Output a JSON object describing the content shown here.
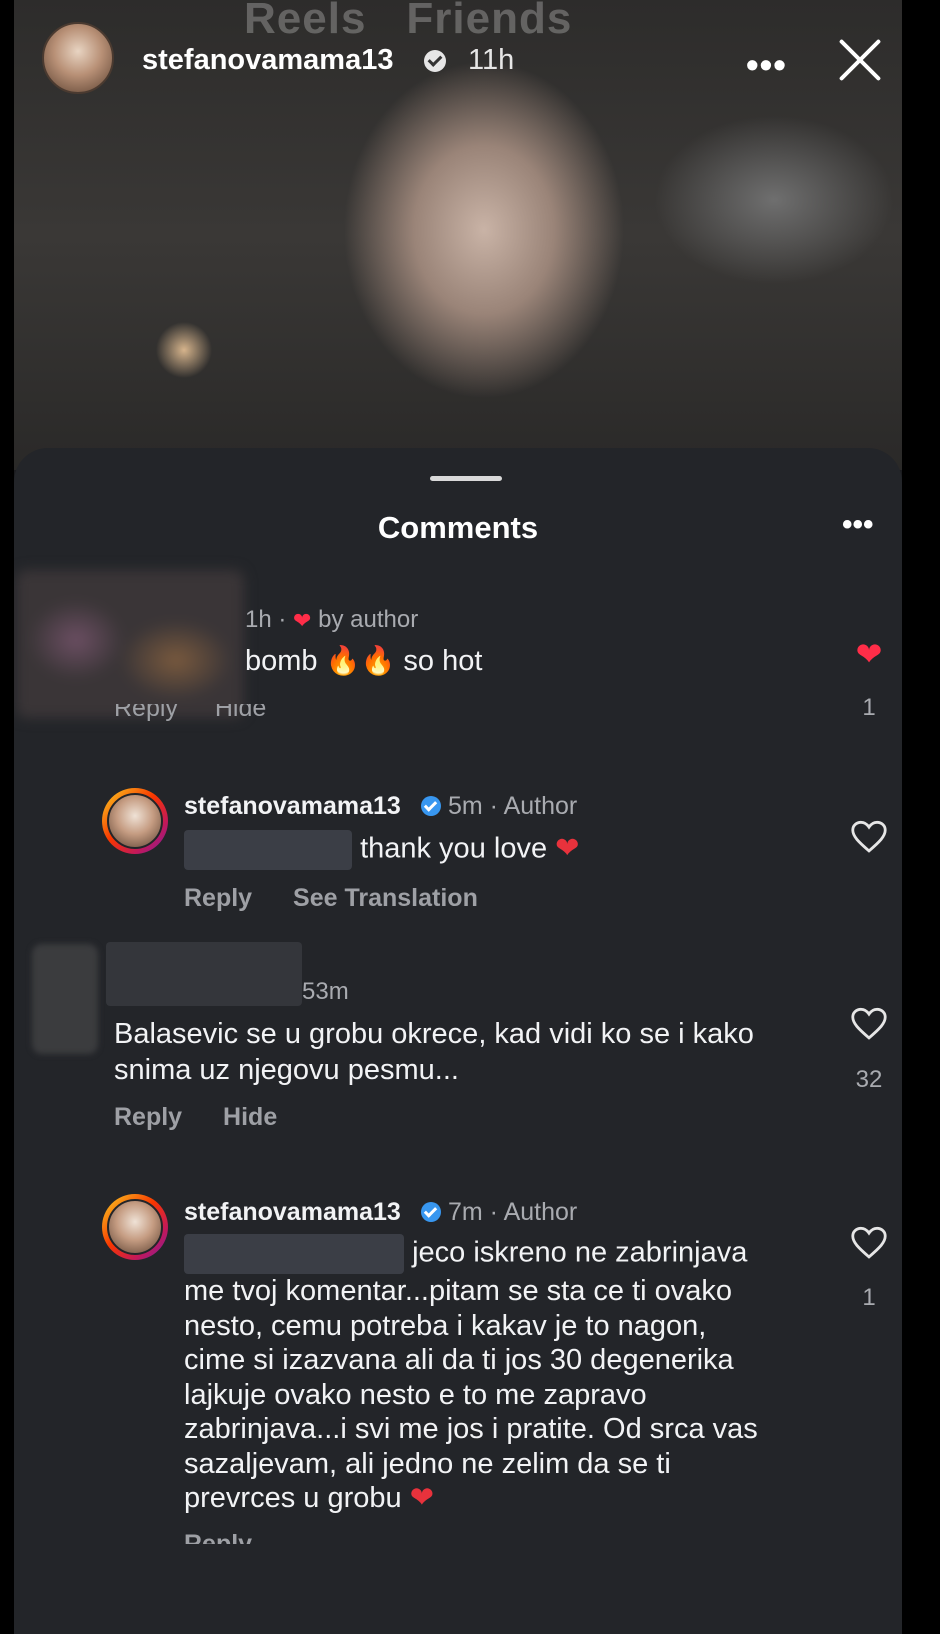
{
  "story": {
    "ghost_tabs": [
      "Reels",
      "Friends"
    ],
    "username": "stefanovamama13",
    "time": "11h",
    "more_label": "•••"
  },
  "sheet": {
    "title": "Comments",
    "more_label": "•••"
  },
  "comments": [
    {
      "time": "1h",
      "liked_by": "by author",
      "text_before": "bomb",
      "text_after": "so hot",
      "actions": [
        "Reply",
        "Hide"
      ],
      "likes": "1",
      "liked": true
    },
    {
      "username": "stefanovamama13",
      "time": "5m",
      "role": "Author",
      "text": "thank you love",
      "actions": [
        "Reply",
        "See Translation"
      ]
    },
    {
      "time": "53m",
      "text": "Balasevic se u grobu okrece, kad vidi ko se i kako snima uz njegovu pesmu...",
      "actions": [
        "Reply",
        "Hide"
      ],
      "likes": "32"
    },
    {
      "username": "stefanovamama13",
      "time": "7m",
      "role": "Author",
      "lines": [
        "jeco iskreno ne zabrinjava",
        "me tvoj komentar...pitam se sta ce ti ovako",
        "nesto, cemu potreba i kakav je to nagon,",
        "cime si izazvana ali da ti jos 30 degenerika",
        "lajkuje ovako nesto e to me zapravo",
        "zabrinjava...i svi me jos i pratite. Od srca vas",
        "sazaljevam, ali jedno ne zelim da se ti",
        "prevrces u grobu"
      ],
      "likes": "1",
      "cut_action": "Reply"
    }
  ],
  "colors": {
    "sheet_bg": "#232529",
    "like_red": "#ff2d48",
    "verified_blue": "#3897f0"
  }
}
